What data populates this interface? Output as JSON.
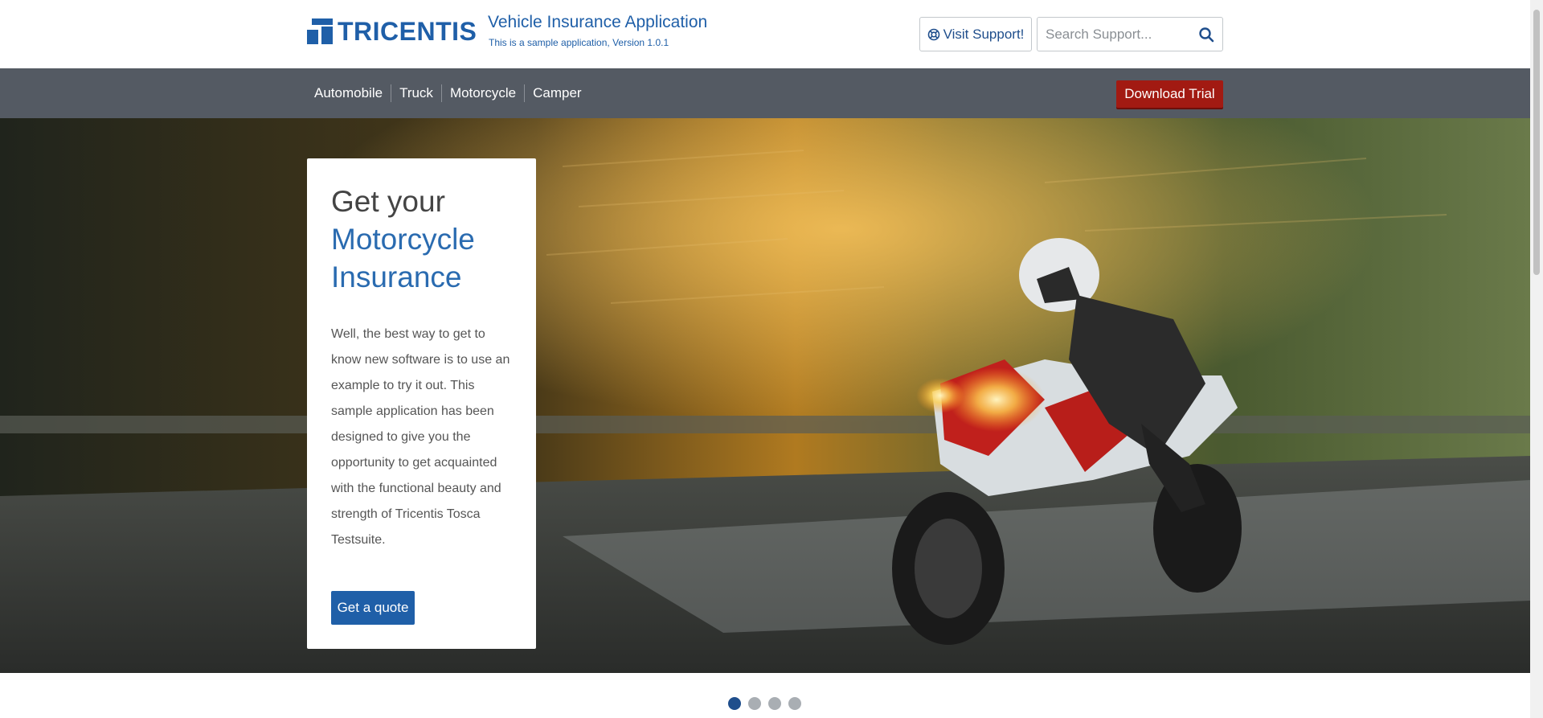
{
  "brand": {
    "logo_text": "TRICENTIS",
    "color": "#1f5fa8"
  },
  "header": {
    "title": "Vehicle Insurance Application",
    "subtitle": "This is a sample application, Version 1.0.1",
    "support_button": "Visit Support!",
    "support_icon": "lifebuoy-icon",
    "search_placeholder": "Search Support...",
    "search_icon": "search-icon"
  },
  "nav": {
    "items": [
      "Automobile",
      "Truck",
      "Motorcycle",
      "Camper"
    ],
    "download_button": "Download Trial",
    "download_color": "#a21a12"
  },
  "hero": {
    "heading_line1": "Get your",
    "heading_highlight": "Motorcycle Insurance",
    "body": "Well, the best way to get to know new software is to use an example to try it out. This sample application has been designed to give you the opportunity to get acquainted with the functional beauty and strength of Tricentis Tosca Testsuite.",
    "cta": "Get a quote"
  },
  "carousel": {
    "slide_count": 4,
    "active_index": 0
  }
}
